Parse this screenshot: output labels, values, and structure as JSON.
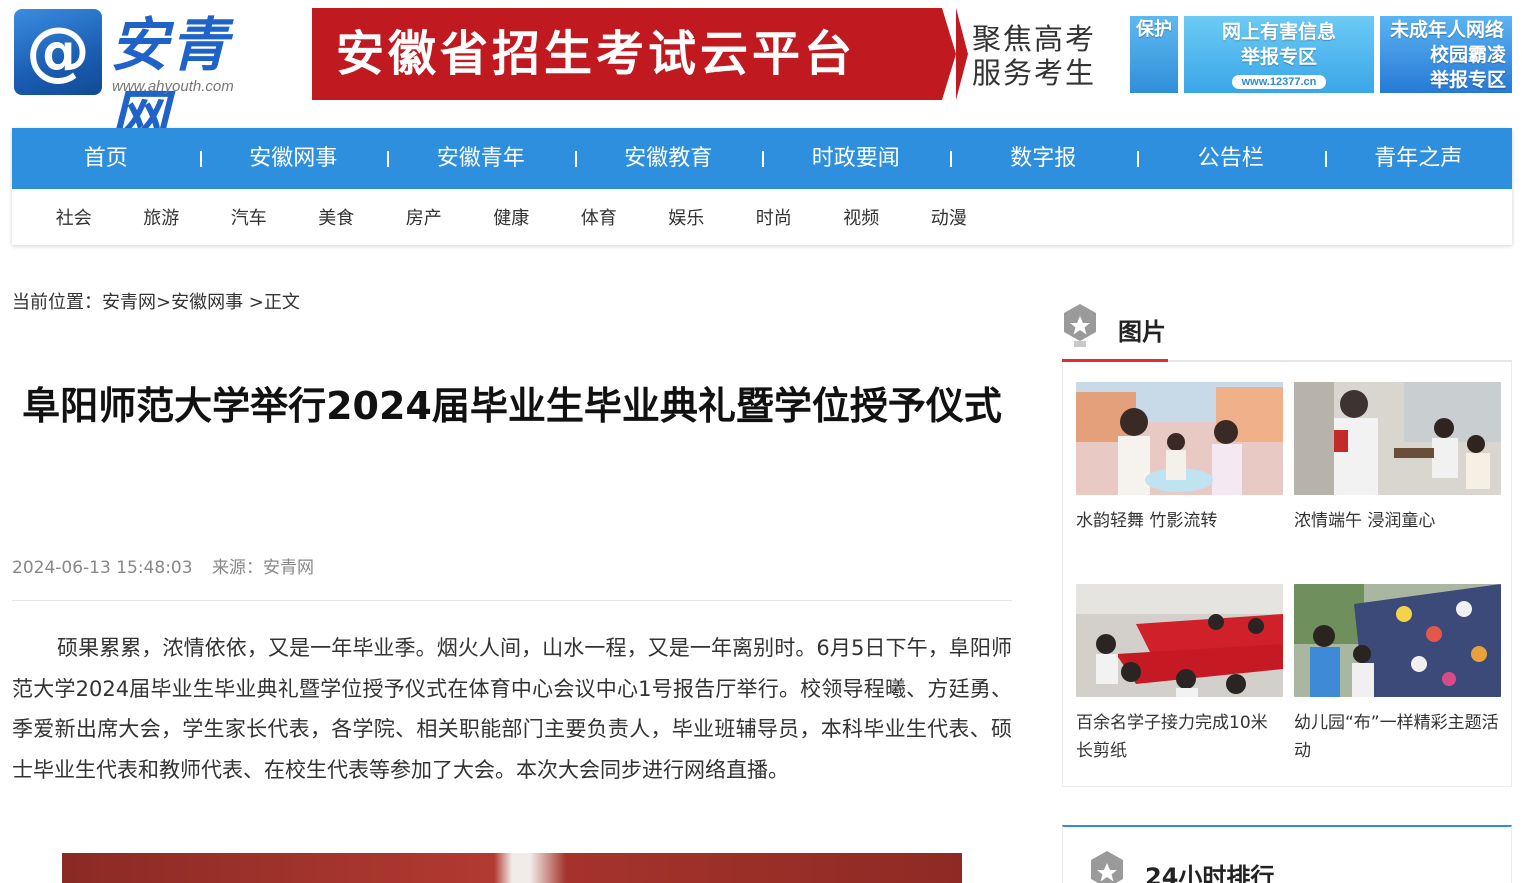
{
  "header": {
    "logo_symbol": "@",
    "logo_text": "安青网",
    "logo_url": "www.ahyouth.com",
    "banner_title": "安徽省招生考试云平台",
    "banner_slogan": "聚焦高考服务考生",
    "ads": [
      {
        "lines": [
          "保护"
        ],
        "pill": ""
      },
      {
        "lines": [
          "网上有害信息",
          "举报专区"
        ],
        "pill": "www.12377.cn"
      },
      {
        "lines": [
          "未成年人网络",
          "校园霸凌",
          "举报专区"
        ],
        "pill": ""
      }
    ]
  },
  "nav": {
    "main": [
      "首页",
      "安徽网事",
      "安徽青年",
      "安徽教育",
      "时政要闻",
      "数字报",
      "公告栏",
      "青年之声"
    ],
    "sub": [
      "社会",
      "旅游",
      "汽车",
      "美食",
      "房产",
      "健康",
      "体育",
      "娱乐",
      "时尚",
      "视频",
      "动漫"
    ]
  },
  "article": {
    "breadcrumb": "当前位置：安青网>安徽网事 >正文",
    "title": "阜阳师范大学举行2024届毕业生毕业典礼暨学位授予仪式",
    "date": "2024-06-13 15:48:03",
    "source": "来源：安青网",
    "body": "硕果累累，浓情依依，又是一年毕业季。烟火人间，山水一程，又是一年离别时。6月5日下午，阜阳师范大学2024届毕业生毕业典礼暨学位授予仪式在体育中心会议中心1号报告厅举行。校领导程曦、方廷勇、季爱新出席大会，学生家长代表，各学院、相关职能部门主要负责人，毕业班辅导员，本科毕业生代表、硕士毕业生代表和教师代表、在校生代表等参加了大会。本次大会同步进行网络直播。"
  },
  "sidebar": {
    "gallery_title": "图片",
    "gallery": [
      {
        "caption": "水韵轻舞 竹影流转"
      },
      {
        "caption": "浓情端午 浸润童心"
      },
      {
        "caption": "百余名学子接力完成10米长剪纸"
      },
      {
        "caption": "幼儿园“布”一样精彩主题活动"
      }
    ],
    "ranking_title": "24小时排行"
  },
  "colors": {
    "nav_blue": "#2e8fdf",
    "banner_red": "#c01920",
    "accent_red": "#e02d2d"
  }
}
